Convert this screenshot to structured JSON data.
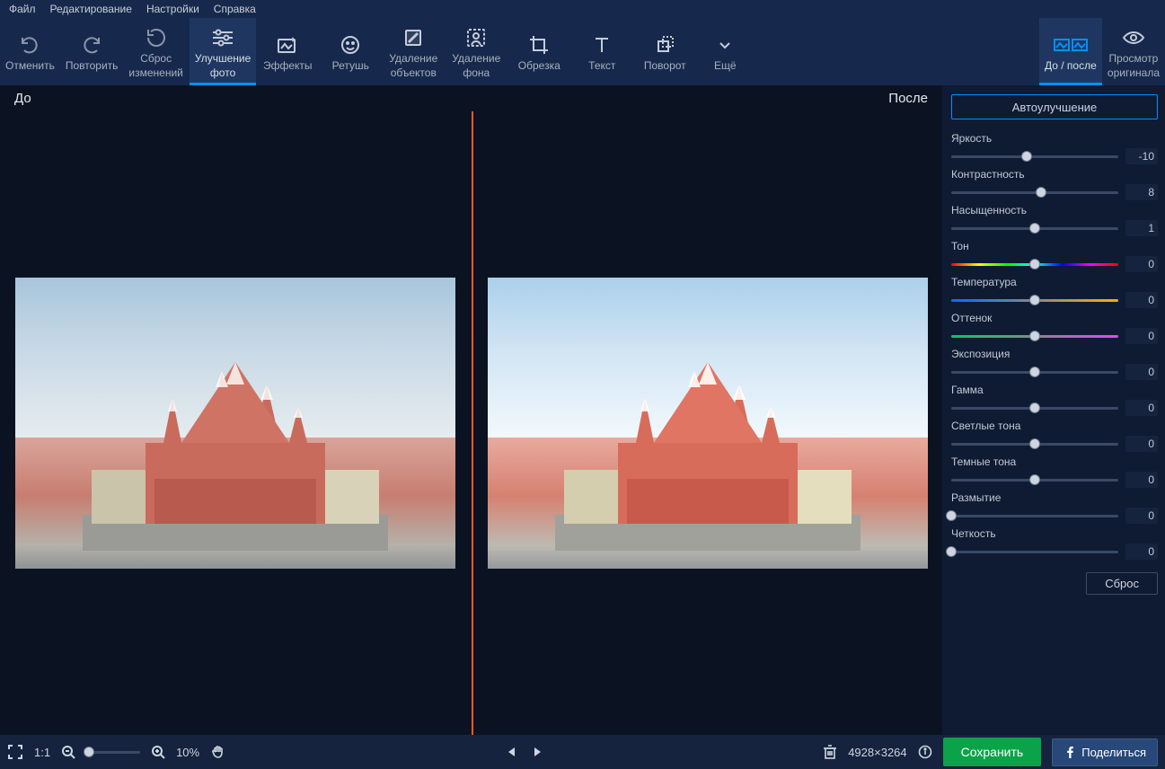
{
  "menu": {
    "file": "Файл",
    "edit": "Редактирование",
    "settings": "Настройки",
    "help": "Справка"
  },
  "toolbar": {
    "undo": "Отменить",
    "redo": "Повторить",
    "reset_changes_l1": "Сброс",
    "reset_changes_l2": "изменений",
    "enhance_l1": "Улучшение",
    "enhance_l2": "фото",
    "effects": "Эффекты",
    "retouch": "Ретушь",
    "remove_objects_l1": "Удаление",
    "remove_objects_l2": "объектов",
    "remove_bg_l1": "Удаление",
    "remove_bg_l2": "фона",
    "crop": "Обрезка",
    "text": "Текст",
    "rotate": "Поворот",
    "more": "Ещё",
    "before_after": "До / после",
    "view_original_l1": "Просмотр",
    "view_original_l2": "оригинала"
  },
  "canvas": {
    "before_label": "До",
    "after_label": "После"
  },
  "panel": {
    "auto_enhance": "Автоулучшение",
    "reset": "Сброс",
    "sliders": [
      {
        "label": "Яркость",
        "value": "-10",
        "pos": 45,
        "track": "plain"
      },
      {
        "label": "Контрастность",
        "value": "8",
        "pos": 54,
        "track": "plain"
      },
      {
        "label": "Насыщенность",
        "value": "1",
        "pos": 50,
        "track": "plain"
      },
      {
        "label": "Тон",
        "value": "0",
        "pos": 50,
        "track": "hue"
      },
      {
        "label": "Температура",
        "value": "0",
        "pos": 50,
        "track": "temp"
      },
      {
        "label": "Оттенок",
        "value": "0",
        "pos": 50,
        "track": "tint"
      },
      {
        "label": "Экспозиция",
        "value": "0",
        "pos": 50,
        "track": "plain"
      },
      {
        "label": "Гамма",
        "value": "0",
        "pos": 50,
        "track": "plain"
      },
      {
        "label": "Светлые тона",
        "value": "0",
        "pos": 50,
        "track": "plain"
      },
      {
        "label": "Темные тона",
        "value": "0",
        "pos": 50,
        "track": "plain"
      },
      {
        "label": "Размытие",
        "value": "0",
        "pos": 0,
        "track": "plain"
      },
      {
        "label": "Четкость",
        "value": "0",
        "pos": 0,
        "track": "plain"
      }
    ]
  },
  "bottombar": {
    "fit_label": "1:1",
    "zoom_percent": "10%",
    "dimensions": "4928×3264",
    "save": "Сохранить",
    "share": "Поделиться"
  }
}
